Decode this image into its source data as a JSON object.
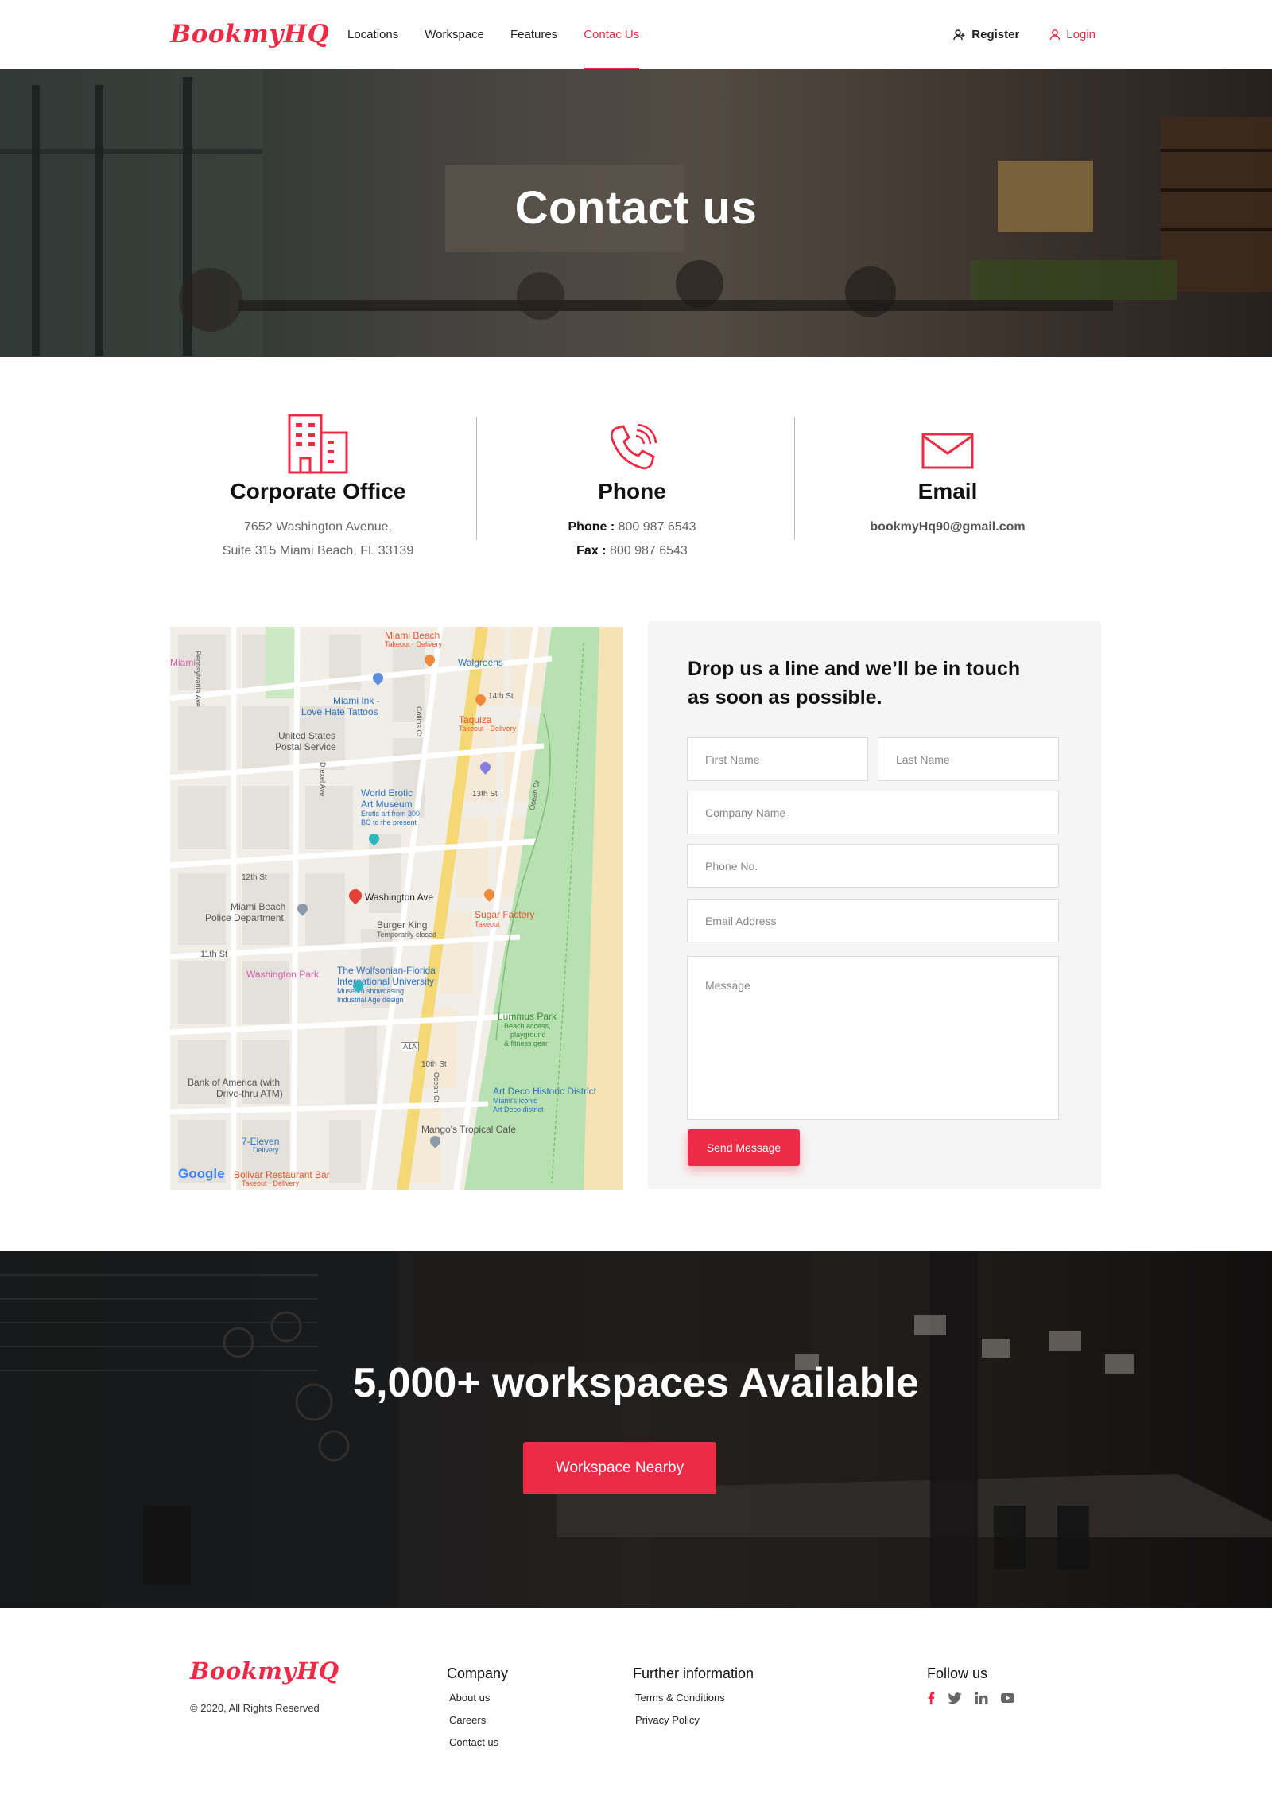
{
  "brand": {
    "logo_text": "BookmyHQ",
    "accent_color": "#ee2b46"
  },
  "nav": {
    "links": [
      "Locations",
      "Workspace",
      "Features",
      "Contac Us"
    ],
    "active_index": 3,
    "register_label": "Register",
    "login_label": "Login"
  },
  "hero": {
    "title": "Contact us"
  },
  "contact_info": {
    "office": {
      "title": "Corporate Office",
      "line1": "7652 Washington Avenue,",
      "line2": "Suite 315 Miami Beach, FL 33139",
      "icon": "building-icon"
    },
    "phone": {
      "title": "Phone",
      "phone_label": "Phone :",
      "phone_value": "800 987 6543",
      "fax_label": "Fax :",
      "fax_value": "800 987 6543",
      "icon": "phone-icon"
    },
    "email": {
      "title": "Email",
      "address": "bookmyHq90@gmail.com",
      "icon": "envelope-icon"
    }
  },
  "map": {
    "labels": {
      "miami_beach": "Miami Beach",
      "takeout_delivery": "Takeout · Delivery",
      "walgreens": "Walgreens",
      "miami": "Miami",
      "pennsylvania_ave": "Pennsylvania Ave",
      "street_14th": "14th St",
      "miami_ink": "Miami Ink -",
      "love_hate_tattoos": "Love Hate Tattoos",
      "taquiza": "Taquiza",
      "collins_ct": "Collins Ct",
      "usps_1": "United States",
      "usps_2": "Postal Service",
      "drexel_ave": "Drexel Ave",
      "street_13th": "13th St",
      "world_erotic_1": "World Erotic",
      "world_erotic_2": "Art Museum",
      "world_erotic_3": "Erotic art from 300",
      "world_erotic_4": "BC to the present",
      "ocean_dr": "Ocean Dr",
      "street_12th": "12th St",
      "washington_ave": "Washington Ave",
      "police_1": "Miami Beach",
      "police_2": "Police Department",
      "sugar_factory": "Sugar Factory",
      "takeout": "Takeout",
      "burger_king": "Burger King",
      "temporarily_closed": "Temporarily closed",
      "street_11th": "11th St",
      "washington_park": "Washington Park",
      "wolfsonian_1": "The Wolfsonian-Florida",
      "wolfsonian_2": "International University",
      "wolfsonian_3": "Museum showcasing",
      "wolfsonian_4": "Industrial Age design",
      "lummus_park": "Lummus Park",
      "lummus_1": "Beach access,",
      "lummus_2": "playground",
      "lummus_3": "& fitness gear",
      "a1a": "A1A",
      "street_10th": "10th St",
      "boa_1": "Bank of America (with",
      "boa_2": "Drive-thru ATM)",
      "art_deco_1": "Art Deco Historic District",
      "art_deco_2": "Miami's iconic",
      "art_deco_3": "Art Deco district",
      "ocean_ct": "Ocean Ct",
      "mangos": "Mango's Tropical Cafe",
      "seven_eleven": "7-Eleven",
      "delivery": "Delivery",
      "bolivar": "Bolivar Restaurant Bar",
      "google": "Google"
    }
  },
  "form": {
    "heading": "Drop us a line and we’ll be in touch as soon as possible.",
    "first_name_placeholder": "First Name",
    "last_name_placeholder": "Last Name",
    "company_placeholder": "Company Name",
    "phone_placeholder": "Phone No.",
    "email_placeholder": "Email Address",
    "message_placeholder": "Message",
    "submit_label": "Send Message"
  },
  "cta": {
    "title": "5,000+ workspaces Available",
    "button_label": "Workspace Nearby"
  },
  "footer": {
    "copyright": "© 2020, All Rights Reserved",
    "company": {
      "heading": "Company",
      "links": [
        "About us",
        "Careers",
        "Contact us"
      ]
    },
    "further": {
      "heading": "Further information",
      "links": [
        "Terms & Conditions",
        "Privacy Policy"
      ]
    },
    "follow": {
      "heading": "Follow us",
      "icons": [
        "facebook-icon",
        "twitter-icon",
        "linkedin-icon",
        "youtube-icon"
      ]
    }
  }
}
